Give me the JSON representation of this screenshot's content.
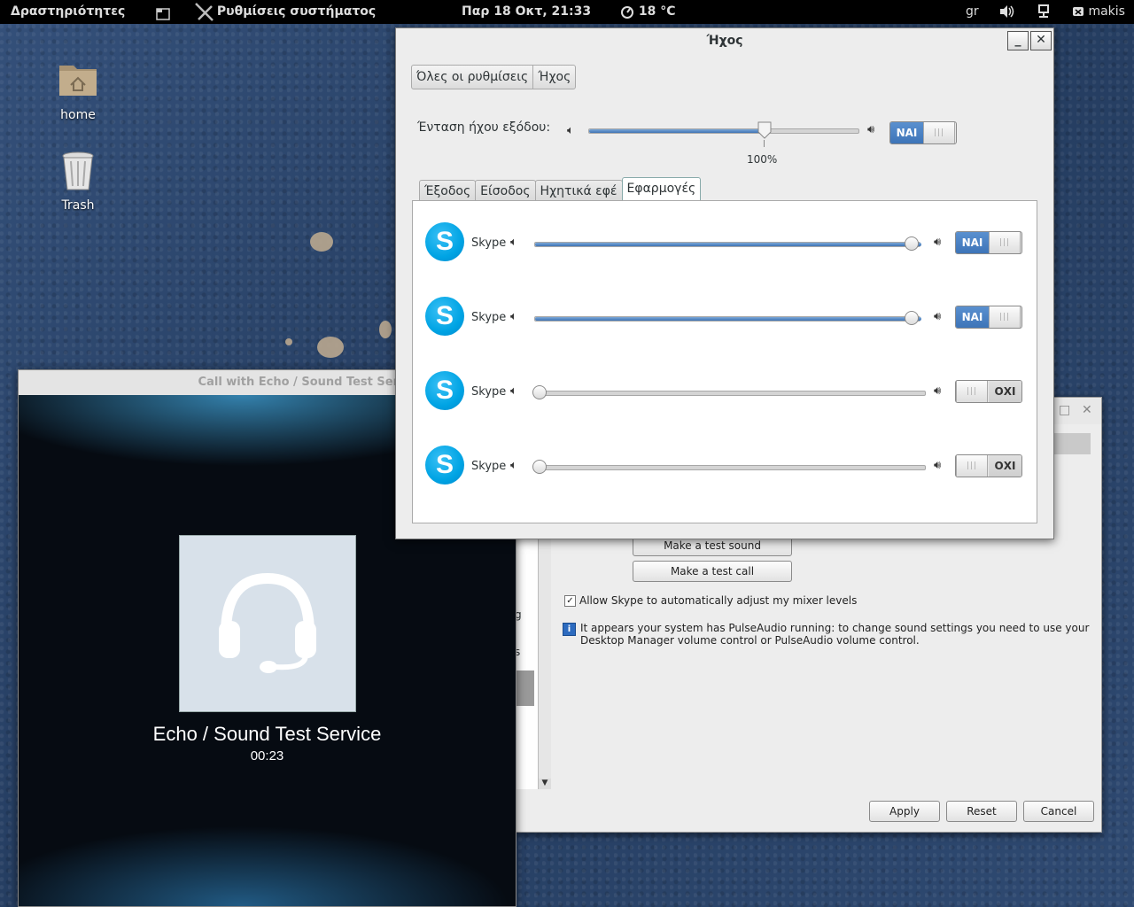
{
  "topbar": {
    "activities": "Δραστηριότητες",
    "app_menu": "Ρυθμίσεις συστήματος",
    "clock": "Παρ 18 Οκτ, 21:33",
    "weather": "18 °C",
    "lang": "gr",
    "user": "makis"
  },
  "desktop": {
    "home_label": "home",
    "trash_label": "Trash"
  },
  "sound_window": {
    "title": "Ήχος",
    "minimize": "_",
    "close": "✕",
    "breadcrumb_all": "Όλες οι ρυθμίσεις",
    "breadcrumb_sound": "Ήχος",
    "volume_label": "Ένταση ήχου εξόδου:",
    "volume_percent": "100%",
    "volume_level": 0.65,
    "output_toggle": "ΝΑΙ",
    "tabs": [
      "Έξοδος",
      "Είσοδος",
      "Ηχητικά εφέ",
      "Εφαρμογές"
    ],
    "active_tab": 3,
    "apps": [
      {
        "name": "Skype",
        "level": 1.0,
        "toggle": "ΝΑΙ",
        "on": true
      },
      {
        "name": "Skype",
        "level": 1.0,
        "toggle": "ΝΑΙ",
        "on": true
      },
      {
        "name": "Skype",
        "level": 0.0,
        "toggle": "ΟΧΙ",
        "on": false
      },
      {
        "name": "Skype",
        "level": 0.0,
        "toggle": "ΟΧΙ",
        "on": false
      }
    ],
    "accent_color": "#3d74b8"
  },
  "call_window": {
    "title": "Call with Echo / Sound Test Service",
    "caller": "Echo / Sound Test Service",
    "duration": "00:23"
  },
  "skype_options": {
    "make_test_sound": "Make a test sound",
    "make_test_call": "Make a test call",
    "allow_mixer_label": "Allow Skype to automatically adjust my mixer levels",
    "allow_mixer_checked": true,
    "info_text_line1": "It appears your system has PulseAudio running: to change sound settings you need to use your",
    "info_text_line2": "Desktop Manager volume control or PulseAudio volume control.",
    "side_g": "g",
    "side_s": "s",
    "apply": "Apply",
    "reset": "Reset",
    "cancel": "Cancel"
  }
}
